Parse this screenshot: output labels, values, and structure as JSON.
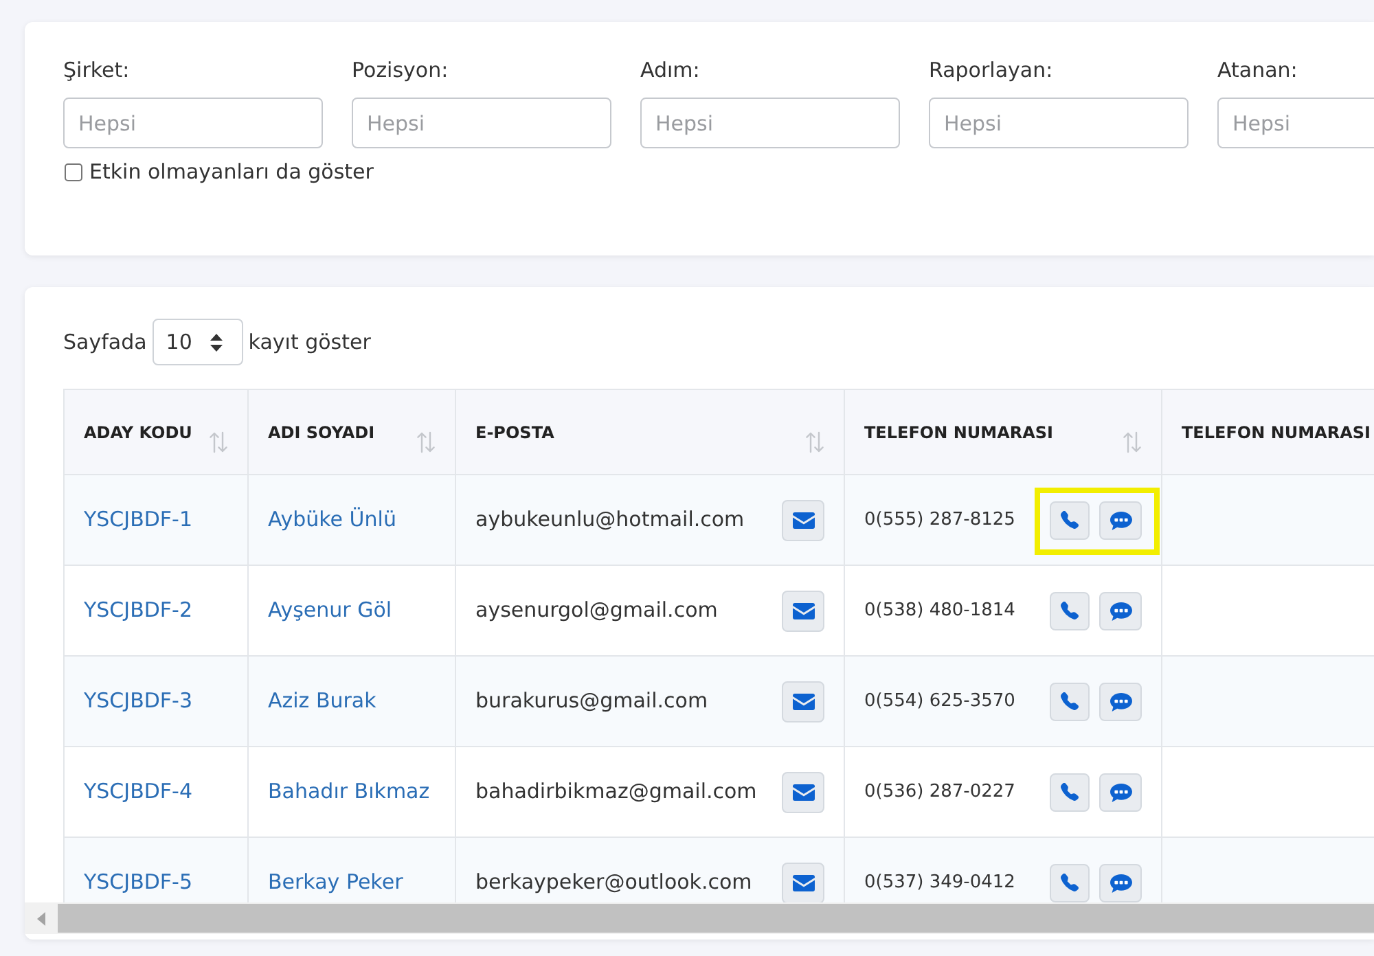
{
  "filters": [
    {
      "label": "Şirket:",
      "placeholder": "Hepsi"
    },
    {
      "label": "Pozisyon:",
      "placeholder": "Hepsi"
    },
    {
      "label": "Adım:",
      "placeholder": "Hepsi"
    },
    {
      "label": "Raporlayan:",
      "placeholder": "Hepsi"
    },
    {
      "label": "Atanan:",
      "placeholder": "Hepsi"
    }
  ],
  "show_inactive": {
    "label": "Etkin olmayanları da göster",
    "checked": false
  },
  "page_length": {
    "prefix": "Sayfada",
    "value": "10",
    "suffix": "kayıt göster"
  },
  "table": {
    "columns": [
      {
        "label": "ADAY KODU",
        "sortable": true
      },
      {
        "label": "ADI SOYADI",
        "sortable": true
      },
      {
        "label": "E-POSTA",
        "sortable": true
      },
      {
        "label": "TELEFON NUMARASI",
        "sortable": true
      },
      {
        "label": "TELEFON NUMARASI",
        "sortable": false
      }
    ],
    "rows": [
      {
        "code": "YSCJBDF-1",
        "name": "Aybüke Ünlü",
        "email": "aybukeunlu@hotmail.com",
        "phone": "0(555) 287-8125",
        "highlighted": true
      },
      {
        "code": "YSCJBDF-2",
        "name": "Ayşenur Göl",
        "email": "aysenurgol@gmail.com",
        "phone": "0(538) 480-1814",
        "highlighted": false
      },
      {
        "code": "YSCJBDF-3",
        "name": "Aziz Burak",
        "email": "burakurus@gmail.com",
        "phone": "0(554) 625-3570",
        "highlighted": false
      },
      {
        "code": "YSCJBDF-4",
        "name": "Bahadır Bıkmaz",
        "email": "bahadirbikmaz@gmail.com",
        "phone": "0(536) 287-0227",
        "highlighted": false
      },
      {
        "code": "YSCJBDF-5",
        "name": "Berkay Peker",
        "email": "berkaypeker@outlook.com",
        "phone": "0(537) 349-0412",
        "highlighted": false
      }
    ]
  }
}
